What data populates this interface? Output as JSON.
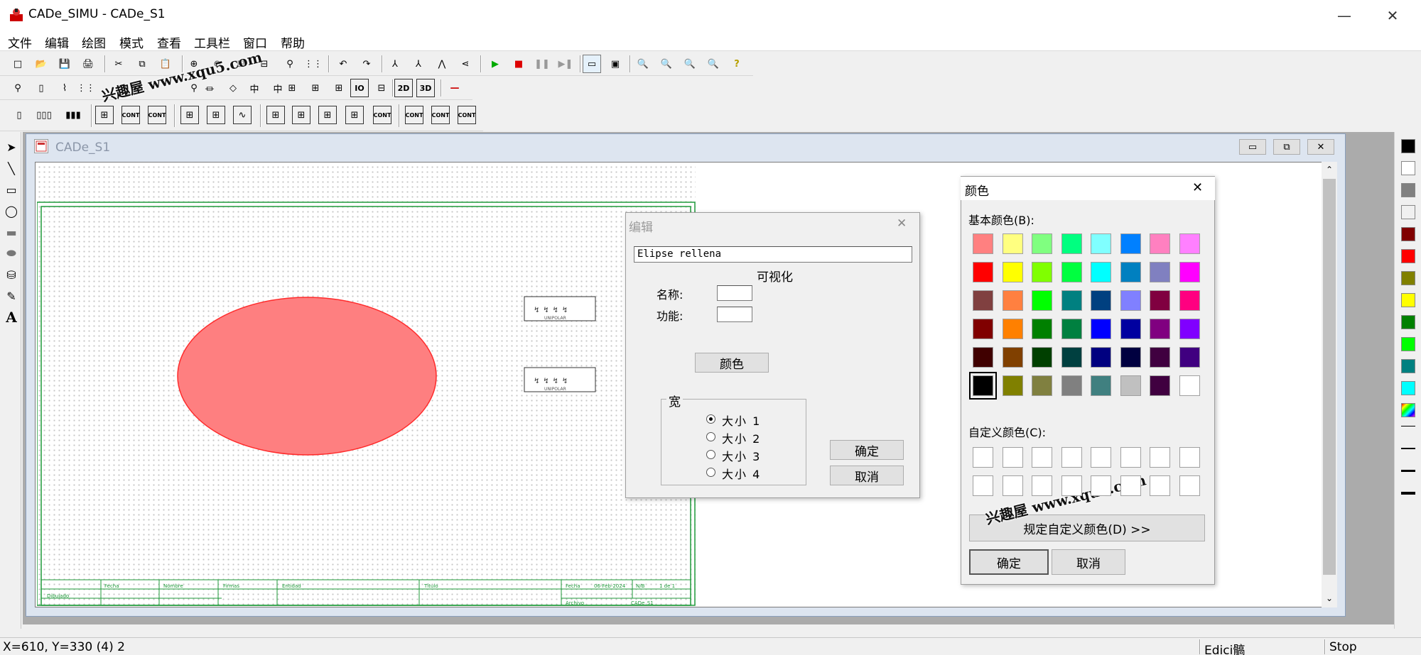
{
  "window": {
    "title": "CADe_SIMU - CADe_S1",
    "min": "—",
    "max": "☐",
    "close": "✕"
  },
  "menu": [
    "文件",
    "编辑",
    "绘图",
    "模式",
    "查看",
    "工具栏",
    "窗口",
    "帮助"
  ],
  "toolbar1": [
    "□",
    "📂",
    "💾",
    "🖨",
    "✂",
    "⧉",
    "📋",
    "⊕",
    "⊖",
    "⊞",
    "⊟",
    "⚲",
    "⋮⋮",
    "↶",
    "↷",
    "⅄",
    "⅄",
    "⋀",
    "⋖",
    "▶",
    "■",
    "❚❚",
    "▶❚",
    "▭",
    "▣",
    "🔍",
    "🔍",
    "🔍",
    "🔍",
    "?"
  ],
  "toolbar2": [
    "⚲",
    "▯",
    "⌇",
    "⋮⋮",
    "⚲",
    "⏛",
    "◇",
    "中",
    "中",
    "⊞",
    "⊞",
    "⊞",
    "IO",
    "⊟",
    "2D",
    "3D",
    "—"
  ],
  "toolbar3": [
    "▯",
    "▯▯▯",
    "▮▮▮",
    "⊞",
    "CONT",
    "CONT",
    "⊞",
    "⊞",
    "∿",
    "⊞",
    "⊞",
    "⊞",
    "⊞",
    "CONT",
    "CONT",
    "CONT",
    "CONT"
  ],
  "lefttools": [
    "➤",
    "╲",
    "▭",
    "◯",
    "▬",
    "⬬",
    "⛁",
    "✎",
    "A"
  ],
  "child": {
    "title": "CADe_S1",
    "min": "▭",
    "restore": "⧉",
    "close": "✕"
  },
  "drawing": {
    "ellipse_fill": "#fe7f80",
    "ellipse_stroke": "#ff2b2b",
    "frame_color": "#1f9a3a",
    "unipolar1": "UNIPOLAR",
    "unipolar2": "UNIPOLAR",
    "tb_fecha": "Fecha",
    "tb_nombre": "Nombre",
    "tb_firmas": "Firmas",
    "tb_entidad": "Entidad",
    "tb_titulo": "Título",
    "tb_fecha2": "Fecha",
    "tb_date": "06-Feb-2024",
    "tb_nb": "N/B",
    "tb_page": "1 de 1",
    "tb_dibujado": "Dibujado",
    "tb_archivo": "Archivo",
    "tb_file": "CADe_S1"
  },
  "edit_dialog": {
    "title": "编辑",
    "field": "Elipse rellena",
    "visible": "可视化",
    "name_label": "名称:",
    "func_label": "功能:",
    "name_value": "",
    "func_value": "",
    "color_button": "颜色",
    "width_group": "宽",
    "sizes": [
      "大小 1",
      "大小 2",
      "大小 3",
      "大小 4"
    ],
    "selected_size": 0,
    "ok": "确定",
    "cancel": "取消"
  },
  "color_dialog": {
    "title": "颜色",
    "basic_label": "基本颜色(B):",
    "custom_label": "自定义颜色(C):",
    "define_button": "规定自定义颜色(D) >>",
    "ok": "确定",
    "cancel": "取消",
    "basic": [
      "#ff8080",
      "#ffff80",
      "#80ff80",
      "#00ff80",
      "#80ffff",
      "#0080ff",
      "#ff80c0",
      "#ff80ff",
      "#ff0000",
      "#ffff00",
      "#80ff00",
      "#00ff40",
      "#00ffff",
      "#0080c0",
      "#8080c0",
      "#ff00ff",
      "#804040",
      "#ff8040",
      "#00ff00",
      "#008080",
      "#004080",
      "#8080ff",
      "#800040",
      "#ff0080",
      "#800000",
      "#ff8000",
      "#008000",
      "#008040",
      "#0000ff",
      "#0000a0",
      "#800080",
      "#8000ff",
      "#400000",
      "#804000",
      "#004000",
      "#004040",
      "#000080",
      "#000040",
      "#400040",
      "#400080",
      "#000000",
      "#808000",
      "#808040",
      "#808080",
      "#408080",
      "#c0c0c0",
      "#400040",
      "#ffffff"
    ],
    "selected": 40
  },
  "palette": [
    "#000000",
    "#ffffff",
    "#808080",
    "#f0f0f0",
    "#800000",
    "#ff0000",
    "#808000",
    "#ffff00",
    "#008000",
    "#00ff00",
    "#008080",
    "#00ffff"
  ],
  "status": {
    "coords": "X=610, Y=330 (4) 2",
    "mode": "Edici髇",
    "state": "Stop"
  },
  "watermark": "兴趣屋 www.xqu5.com"
}
